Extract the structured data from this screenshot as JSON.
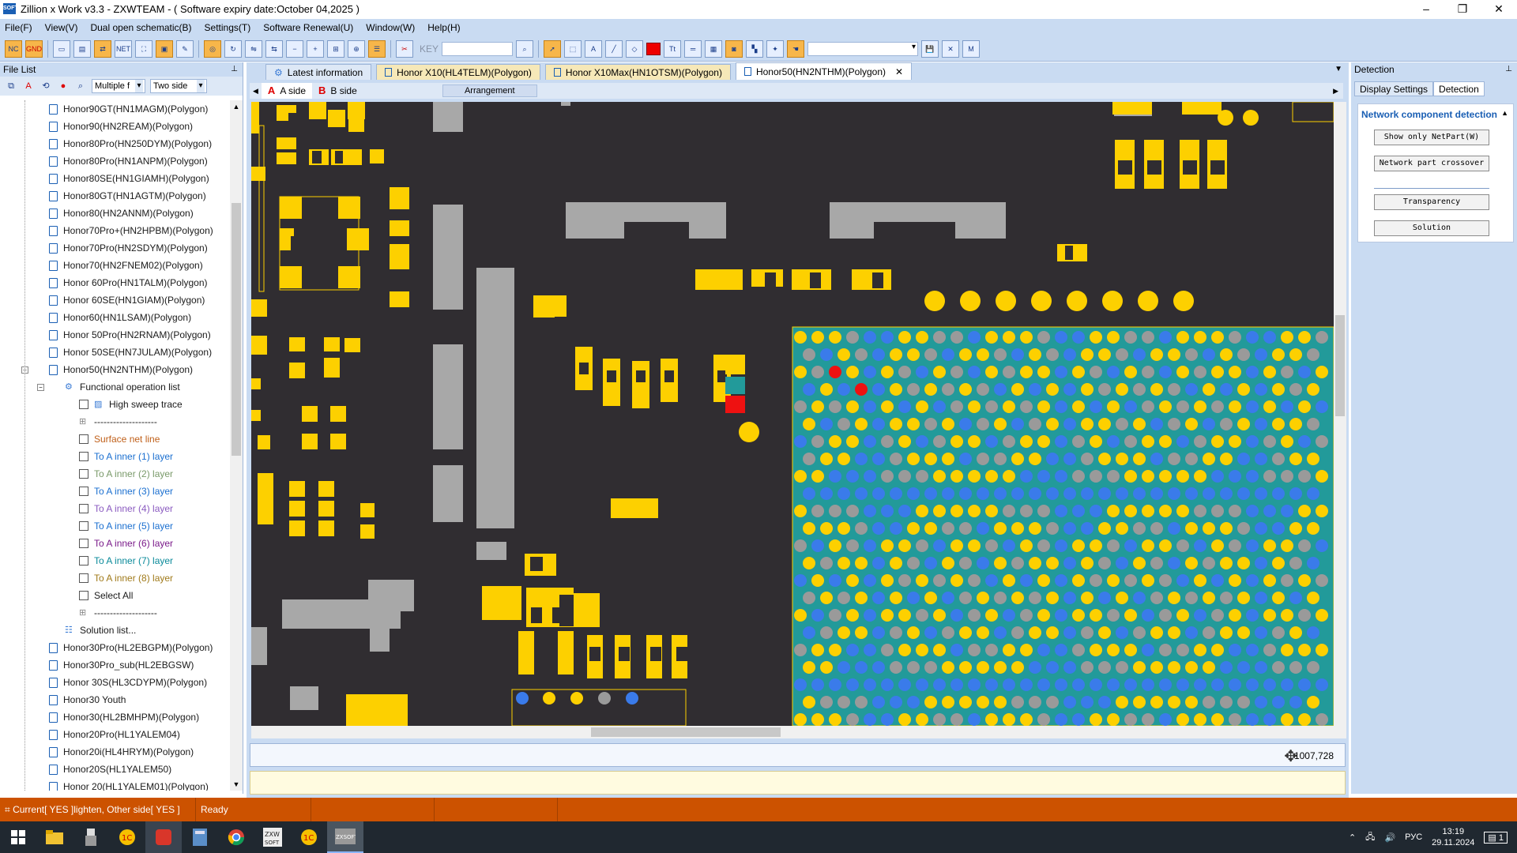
{
  "window": {
    "title": "Zillion x Work v3.3 - ZXWTEAM - ( Software expiry date:October 04,2025 )",
    "minimize": "–",
    "maximize": "❐",
    "close": "✕",
    "logo": "SOFT"
  },
  "menu": [
    "File(F)",
    "View(V)",
    "Dual open schematic(B)",
    "Settings(T)",
    "Software Renewal(U)",
    "Window(W)",
    "Help(H)"
  ],
  "toolbar": {
    "nc": "NC",
    "gnd": "GND",
    "net": "NET",
    "key_label": "KEY",
    "highlight_color": "#ee0000",
    "text_tool": "Tt"
  },
  "left_panel": {
    "title": "File List",
    "pin": "⊥",
    "filter1": "Multiple f",
    "filter2": "Two side",
    "tree": [
      {
        "label": "Honor90GT(HN1MAGM)(Polygon)",
        "type": "file",
        "color": "#1a1a1a"
      },
      {
        "label": "Honor90(HN2REAM)(Polygon)",
        "type": "file",
        "color": "#1a1a1a"
      },
      {
        "label": "Honor80Pro(HN250DYM)(Polygon)",
        "type": "file",
        "color": "#1a1a1a"
      },
      {
        "label": "Honor80Pro(HN1ANPM)(Polygon)",
        "type": "file",
        "color": "#1a1a1a"
      },
      {
        "label": "Honor80SE(HN1GIAMH)(Polygon)",
        "type": "file",
        "color": "#1a1a1a"
      },
      {
        "label": "Honor80GT(HN1AGTM)(Polygon)",
        "type": "file",
        "color": "#1a1a1a"
      },
      {
        "label": "Honor80(HN2ANNM)(Polygon)",
        "type": "file",
        "color": "#1a1a1a"
      },
      {
        "label": "Honor70Pro+(HN2HPBM)(Polygon)",
        "type": "file",
        "color": "#1a1a1a"
      },
      {
        "label": "Honor70Pro(HN2SDYM)(Polygon)",
        "type": "file",
        "color": "#1a1a1a"
      },
      {
        "label": "Honor70(HN2FNEM02)(Polygon)",
        "type": "file",
        "color": "#1a1a1a"
      },
      {
        "label": "Honor 60Pro(HN1TALM)(Polygon)",
        "type": "file",
        "color": "#1a1a1a"
      },
      {
        "label": "Honor 60SE(HN1GIAM)(Polygon)",
        "type": "file",
        "color": "#1a1a1a"
      },
      {
        "label": "Honor60(HN1LSAM)(Polygon)",
        "type": "file",
        "color": "#1a1a1a"
      },
      {
        "label": "Honor 50Pro(HN2RNAM)(Polygon)",
        "type": "file",
        "color": "#1a1a1a"
      },
      {
        "label": "Honor 50SE(HN7JULAM)(Polygon)",
        "type": "file",
        "color": "#1a1a1a"
      },
      {
        "label": "Honor50(HN2NTHM)(Polygon)",
        "type": "file-open",
        "color": "#1a1a1a"
      },
      {
        "label": "Functional operation list",
        "type": "group",
        "color": "#1a1a1a"
      },
      {
        "label": "High sweep trace",
        "type": "check-ico",
        "color": "#1a1a1a"
      },
      {
        "label": "--------------------",
        "type": "sep",
        "color": "#1a1a1a"
      },
      {
        "label": "Surface net line",
        "type": "check",
        "color": "#c0601a"
      },
      {
        "label": "To A inner (1) layer",
        "type": "check",
        "color": "#1a6fd0"
      },
      {
        "label": "To A inner (2) layer",
        "type": "check",
        "color": "#7a9a6a"
      },
      {
        "label": "To A inner (3) layer",
        "type": "check",
        "color": "#1a6fd0"
      },
      {
        "label": "To A inner (4) layer",
        "type": "check",
        "color": "#8a5ac0"
      },
      {
        "label": "To A inner (5) layer",
        "type": "check",
        "color": "#1a6fd0"
      },
      {
        "label": "To A inner (6) layer",
        "type": "check",
        "color": "#7a1a8a"
      },
      {
        "label": "To A inner (7) layer",
        "type": "check",
        "color": "#0a8a9a"
      },
      {
        "label": "To A inner (8) layer",
        "type": "check",
        "color": "#a07a1a"
      },
      {
        "label": "Select All",
        "type": "check",
        "color": "#1a1a1a"
      },
      {
        "label": "--------------------",
        "type": "sep",
        "color": "#1a1a1a"
      },
      {
        "label": "Solution list...",
        "type": "list",
        "color": "#1a1a1a"
      },
      {
        "label": "Honor30Pro(HL2EBGPM)(Polygon)",
        "type": "file",
        "color": "#1a1a1a"
      },
      {
        "label": "Honor30Pro_sub(HL2EBGSW)",
        "type": "file",
        "color": "#1a1a1a"
      },
      {
        "label": "Honor 30S(HL3CDYPM)(Polygon)",
        "type": "file",
        "color": "#1a1a1a"
      },
      {
        "label": "Honor30 Youth",
        "type": "file",
        "color": "#1a1a1a"
      },
      {
        "label": "Honor30(HL2BMHPM)(Polygon)",
        "type": "file",
        "color": "#1a1a1a"
      },
      {
        "label": "Honor20Pro(HL1YALEM04)",
        "type": "file",
        "color": "#1a1a1a"
      },
      {
        "label": "Honor20i(HL4HRYM)(Polygon)",
        "type": "file",
        "color": "#1a1a1a"
      },
      {
        "label": "Honor20S(HL1YALEM50)",
        "type": "file",
        "color": "#1a1a1a"
      },
      {
        "label": "Honor 20(HL1YALEM01)(Polygon)",
        "type": "file",
        "color": "#1a1a1a"
      }
    ]
  },
  "tabs": [
    {
      "label": "Latest information",
      "active": false
    },
    {
      "label": "Honor X10(HL4TELM)(Polygon)",
      "active": false
    },
    {
      "label": "Honor X10Max(HN1OTSM)(Polygon)",
      "active": false
    },
    {
      "label": "Honor50(HN2NTHM)(Polygon)",
      "active": true,
      "close": "✕"
    }
  ],
  "board_view": {
    "side_a": "A side",
    "side_b": "B side",
    "side_a_icon": "A",
    "side_b_icon": "B",
    "arrangement": "Arrangement",
    "coordinates": "1007,728",
    "colors": {
      "background": "#302d31",
      "pad": "#fdd000",
      "component": "#a8a8a8",
      "bga_area": "#229a9a",
      "net_blue": "#3a7bea",
      "selected_red": "#ee1111"
    }
  },
  "right_panel": {
    "title": "Detection",
    "pin": "⊥",
    "tab_display": "Display Settings",
    "tab_detection": "Detection",
    "section": "Network component detection",
    "buttons": [
      "Show only NetPart(W)",
      "Network part crossover",
      "Transparency",
      "Solution"
    ]
  },
  "status": {
    "current": "Current[ YES ]lighten, Other side[ YES ]",
    "ready": "Ready"
  },
  "taskbar": {
    "lang": "РУС",
    "time": "13:19",
    "date": "29.11.2024",
    "notify": "1"
  }
}
